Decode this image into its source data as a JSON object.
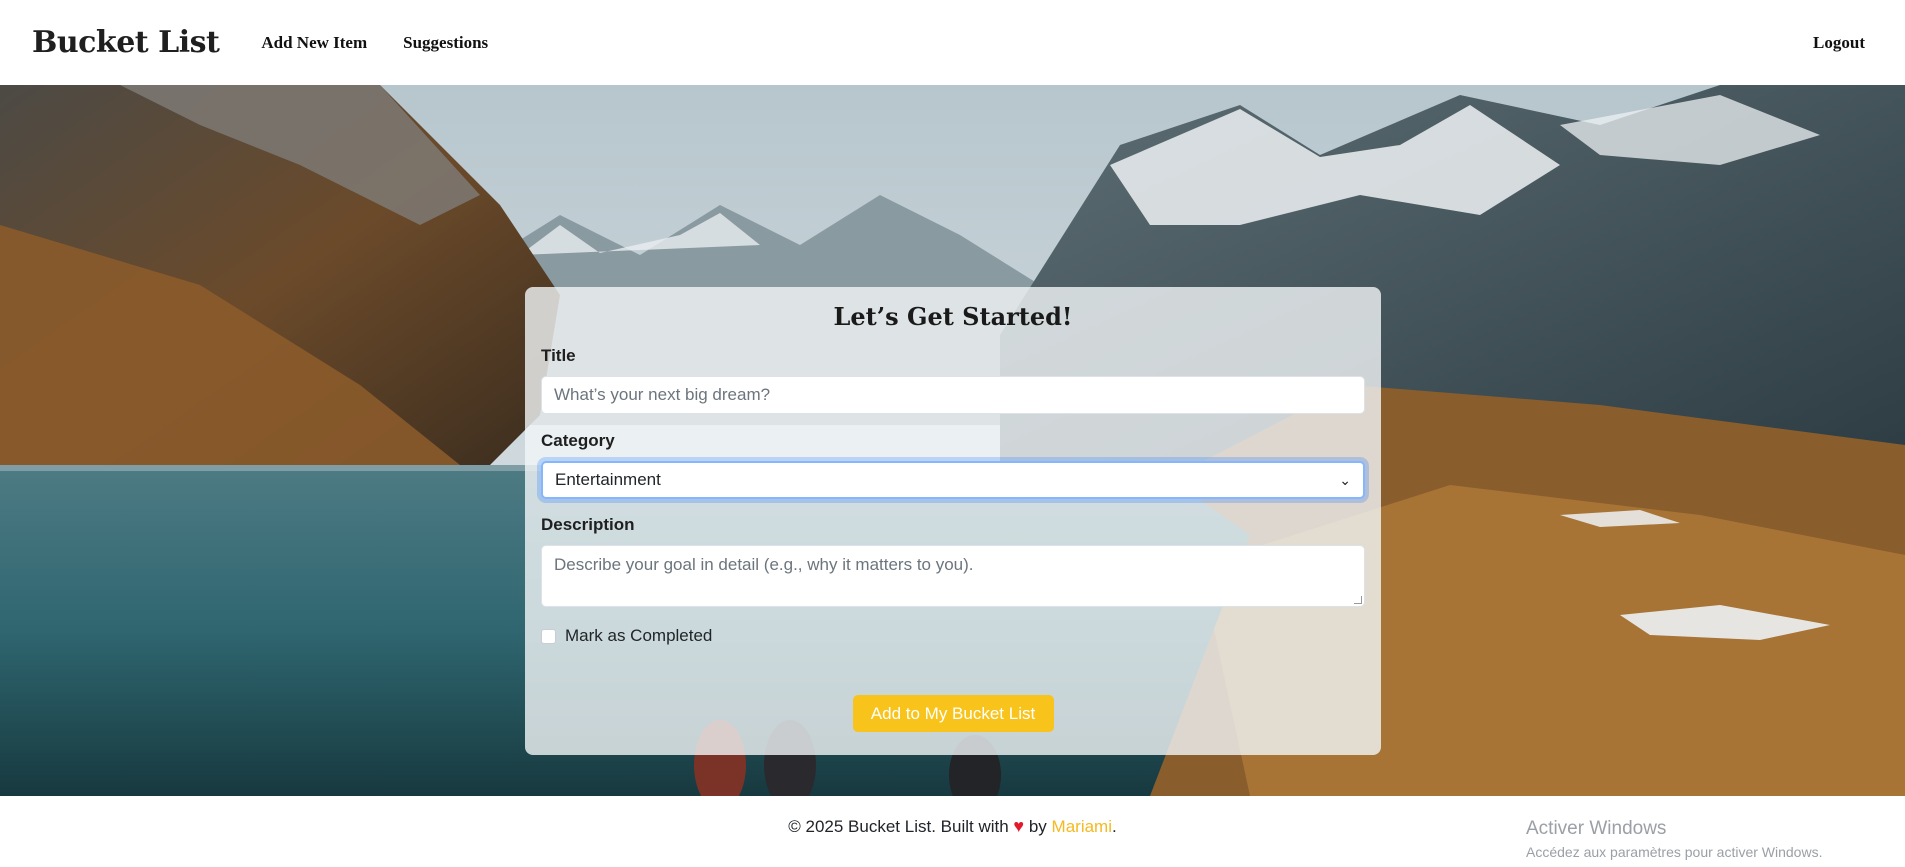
{
  "nav": {
    "brand": "Bucket List",
    "links": [
      "Add New Item",
      "Suggestions"
    ],
    "logout": "Logout"
  },
  "form": {
    "heading": "Let’s Get Started!",
    "title_label": "Title",
    "title_placeholder": "What’s your next big dream?",
    "category_label": "Category",
    "category_selected": "Entertainment",
    "description_label": "Description",
    "description_placeholder": "Describe your goal in detail (e.g., why it matters to you).",
    "completed_label": "Mark as Completed",
    "submit_label": "Add to My Bucket List"
  },
  "footer": {
    "prefix": "© 2025 Bucket List. Built with",
    "by": "by",
    "author": "Mariami",
    "suffix": "."
  },
  "watermark": {
    "line1": "Activer Windows",
    "line2": "Accédez aux paramètres pour activer Windows."
  },
  "colors": {
    "accent": "#f8c31a",
    "author": "#f5b921",
    "heart": "#e21b2c"
  }
}
